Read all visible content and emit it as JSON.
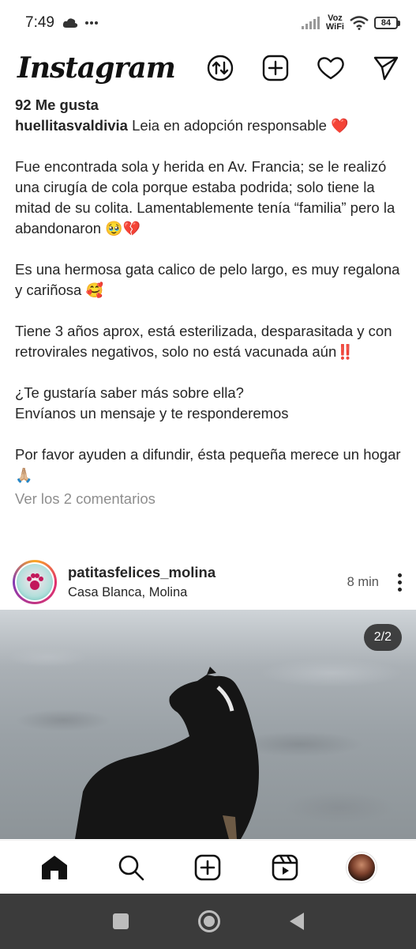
{
  "status_bar": {
    "time": "7:49",
    "network_label_top": "Voz",
    "network_label_bottom": "WiFi",
    "battery": "84"
  },
  "header": {
    "logo": "Instagram",
    "icons": [
      "swap-icon",
      "add-post-icon",
      "heart-icon",
      "send-icon"
    ]
  },
  "post_caption": {
    "likes": "92 Me gusta",
    "username": "huellitasvaldivia",
    "first_line": "Leia en adopción responsable",
    "emoji_heart": "❤️",
    "paragraph_1": "Fue encontrada sola y herida en Av. Francia;  se le realizó una cirugía de cola porque estaba podrida; solo tiene la mitad de su colita. Lamentablemente tenía “familia” pero la abandonaron",
    "emoji_sad": "🥹💔",
    "paragraph_2": "Es una hermosa gata calico de pelo largo, es muy regalona y cariñosa",
    "emoji_love": "🥰",
    "paragraph_3": "Tiene 3 años aprox, está esterilizada, desparasitada y con retrovirales negativos, solo no está vacunada aún",
    "emoji_alert": "‼️",
    "question": "¿Te gustaría saber más sobre ella?",
    "invite": "Envíanos un mensaje y te responderemos",
    "paragraph_4": "Por favor ayuden a difundir, ésta pequeña merece un hogar",
    "emoji_pray": "🙏🏼",
    "comments_link": "Ver los 2 comentarios"
  },
  "next_post": {
    "username": "patitasfelices_molina",
    "location": "Casa Blanca, Molina",
    "time": "8 min",
    "image_counter": "2/2",
    "avatar_icon": "paw-logo-icon"
  },
  "bottom_nav": {
    "items": [
      "home-icon",
      "search-icon",
      "create-icon",
      "reels-icon",
      "profile-avatar"
    ]
  },
  "colors": {
    "text": "#262626",
    "muted": "#8e8e8e",
    "system_bar": "#3b3b3b"
  }
}
